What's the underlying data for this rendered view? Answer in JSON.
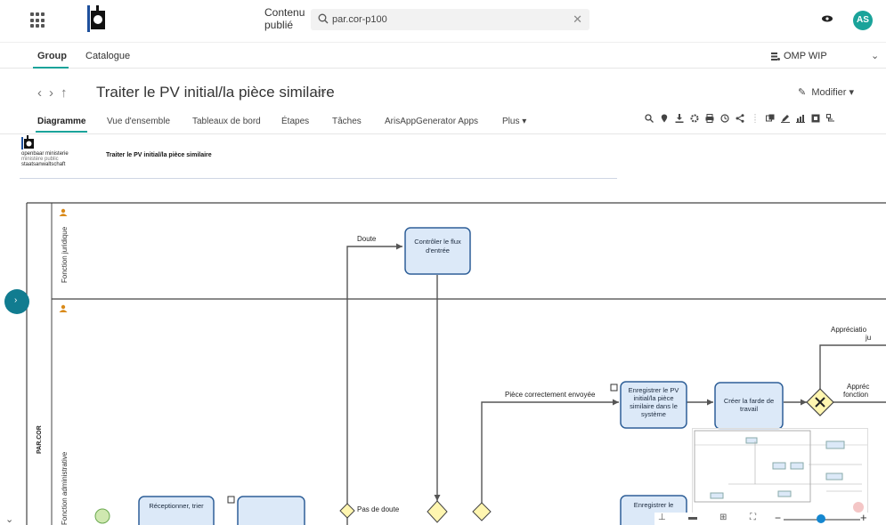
{
  "topbar": {
    "content_label": "Contenu publié",
    "search_value": "par.cor-p100",
    "avatar_initials": "AS"
  },
  "nav2": {
    "group": "Group",
    "catalogue": "Catalogue",
    "workspace": "OMP WIP"
  },
  "title_row": {
    "title": "Traiter le PV initial/la pièce similaire",
    "edit_label": "Modifier ▾"
  },
  "tabs": [
    {
      "label": "Diagramme",
      "active": true
    },
    {
      "label": "Vue d'ensemble"
    },
    {
      "label": "Tableaux de bord"
    },
    {
      "label": "Étapes"
    },
    {
      "label": "Tâches"
    },
    {
      "label": "ArisAppGenerator Apps"
    },
    {
      "label": "Plus ▾"
    }
  ],
  "diagram": {
    "org_line1": "openbaar ministerie",
    "org_line2": "ministère public",
    "org_line3": "staatsanwaltschaft",
    "title": "Traiter le PV initial/la pièce similaire",
    "pool_label": "PAR.COR",
    "lane1_label": "Fonction juridique",
    "lane2_label": "Fonction administrative",
    "tasks": {
      "controler": "Contrôler le flux d'entrée",
      "enregistrer": "Enregistrer le PV initial/la pièce similaire dans le système",
      "creer": "Créer la farde de travail",
      "receptionner": "Réceptionner, trier",
      "enregistrer2": "Enregistrer le"
    },
    "labels": {
      "doute": "Doute",
      "piece_ok": "Pièce correctement envoyée",
      "pas_doute": "Pas de doute",
      "appreciation1_a": "Appréciatio",
      "appreciation1_b": "ju",
      "appreciation2_a": "Appréc",
      "appreciation2_b": "fonction"
    }
  },
  "colors": {
    "accent": "#1aa39a",
    "task_fill": "#dce9f8",
    "task_stroke": "#2e5f98",
    "gateway_fill": "#fff6b0"
  }
}
